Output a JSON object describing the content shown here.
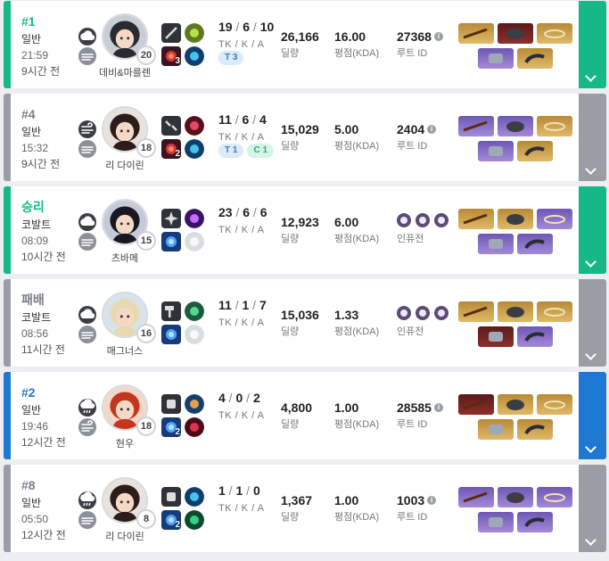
{
  "labels": {
    "kda": "TK / K / A",
    "damage": "딜량",
    "score": "평점(KDA)",
    "route_id": "루트 ID",
    "inhuman": "인퓨전"
  },
  "colors": {
    "green": "#15b886",
    "blue": "#1f78d1",
    "gray": "#9a9ea4"
  },
  "matches": [
    {
      "result": "#1",
      "result_color": "#15b886",
      "bar": "green",
      "mode": "일반",
      "time": "21:59",
      "ago": "9시간 전",
      "weather": [
        "cloud-icon",
        "haze-icon"
      ],
      "character": "데비&마를렌",
      "level": "20",
      "skills": [
        {
          "icon": "blade-icon",
          "badge": ""
        },
        {
          "icon": "burst-icon",
          "badge": "3"
        }
      ],
      "runes": [
        "leaf-rune-icon",
        "blue-rune-icon"
      ],
      "tk": "19",
      "k": "6",
      "a": "10",
      "tags": [
        {
          "text": "T 3",
          "type": "t"
        }
      ],
      "damage": "26,166",
      "score": "16.00",
      "route": "27368",
      "route_type": "id",
      "items": [
        "gold",
        "red",
        "gold",
        "purple",
        "gold"
      ]
    },
    {
      "result": "#4",
      "result_color": "#7a7f86",
      "bar": "gray",
      "mode": "일반",
      "time": "15:32",
      "ago": "9시간 전",
      "weather": [
        "wind-icon",
        "haze-icon"
      ],
      "character": "리 다이린",
      "level": "18",
      "skills": [
        {
          "icon": "nunchaku-icon",
          "badge": ""
        },
        {
          "icon": "fire-icon",
          "badge": "2"
        }
      ],
      "runes": [
        "demon-rune-icon",
        "blue-rune-icon"
      ],
      "tk": "11",
      "k": "6",
      "a": "4",
      "tags": [
        {
          "text": "T 1",
          "type": "t"
        },
        {
          "text": "C 1",
          "type": "c"
        }
      ],
      "damage": "15,029",
      "score": "5.00",
      "route": "2404",
      "route_type": "id",
      "items": [
        "purple",
        "purple",
        "gold",
        "purple",
        "gold"
      ]
    },
    {
      "result": "승리",
      "result_color": "#15b886",
      "bar": "green",
      "mode": "코발트",
      "time": "08:09",
      "ago": "10시간 전",
      "weather": [
        "cloud-icon",
        "haze-icon"
      ],
      "character": "츠바메",
      "level": "15",
      "skills": [
        {
          "icon": "shuriken-icon",
          "badge": ""
        },
        {
          "icon": "blue-skill-icon",
          "badge": ""
        }
      ],
      "runes": [
        "purple-rune-icon",
        "white-rune-icon"
      ],
      "tk": "23",
      "k": "6",
      "a": "6",
      "tags": [],
      "damage": "12,923",
      "score": "6.00",
      "route": "인퓨전",
      "route_type": "inhuman",
      "items": [
        "gold",
        "gold",
        "purple",
        "purple",
        "purple"
      ]
    },
    {
      "result": "패배",
      "result_color": "#7a7f86",
      "bar": "gray",
      "mode": "코발트",
      "time": "08:56",
      "ago": "11시간 전",
      "weather": [
        "cloud-icon",
        "haze-icon"
      ],
      "character": "매그너스",
      "level": "16",
      "skills": [
        {
          "icon": "hammer-icon",
          "badge": ""
        },
        {
          "icon": "blue-skill-icon",
          "badge": ""
        }
      ],
      "runes": [
        "green-rune-icon",
        "white-rune-icon"
      ],
      "tk": "11",
      "k": "1",
      "a": "7",
      "tags": [],
      "damage": "15,036",
      "score": "1.33",
      "route": "인퓨전",
      "route_type": "inhuman",
      "items": [
        "gold",
        "gold",
        "gold",
        "red",
        "purple"
      ]
    },
    {
      "result": "#2",
      "result_color": "#1f78d1",
      "bar": "blue",
      "mode": "일반",
      "time": "19:46",
      "ago": "12시간 전",
      "weather": [
        "rain-icon",
        "wind-icon"
      ],
      "character": "현우",
      "level": "18",
      "skills": [
        {
          "icon": "fist-icon",
          "badge": ""
        },
        {
          "icon": "blue-skill-icon",
          "badge": "2"
        }
      ],
      "runes": [
        "shield-rune-icon",
        "red-rune-icon"
      ],
      "tk": "4",
      "k": "0",
      "a": "2",
      "tags": [],
      "damage": "4,800",
      "score": "1.00",
      "route": "28585",
      "route_type": "id",
      "items": [
        "red",
        "gold",
        "gold",
        "gold",
        "gold"
      ]
    },
    {
      "result": "#8",
      "result_color": "#7a7f86",
      "bar": "gray",
      "mode": "일반",
      "time": "05:50",
      "ago": "12시간 전",
      "weather": [
        "rain-icon",
        "haze-icon"
      ],
      "character": "리 다이린",
      "level": "8",
      "skills": [
        {
          "icon": "fist-icon",
          "badge": ""
        },
        {
          "icon": "blue-skill-icon",
          "badge": "2"
        }
      ],
      "runes": [
        "blue-rune-icon",
        "heal-rune-icon"
      ],
      "tk": "1",
      "k": "1",
      "a": "0",
      "tags": [],
      "damage": "1,367",
      "score": "1.00",
      "route": "1003",
      "route_type": "id",
      "items": [
        "purple",
        "purple",
        "purple",
        "purple",
        "purple"
      ]
    }
  ]
}
